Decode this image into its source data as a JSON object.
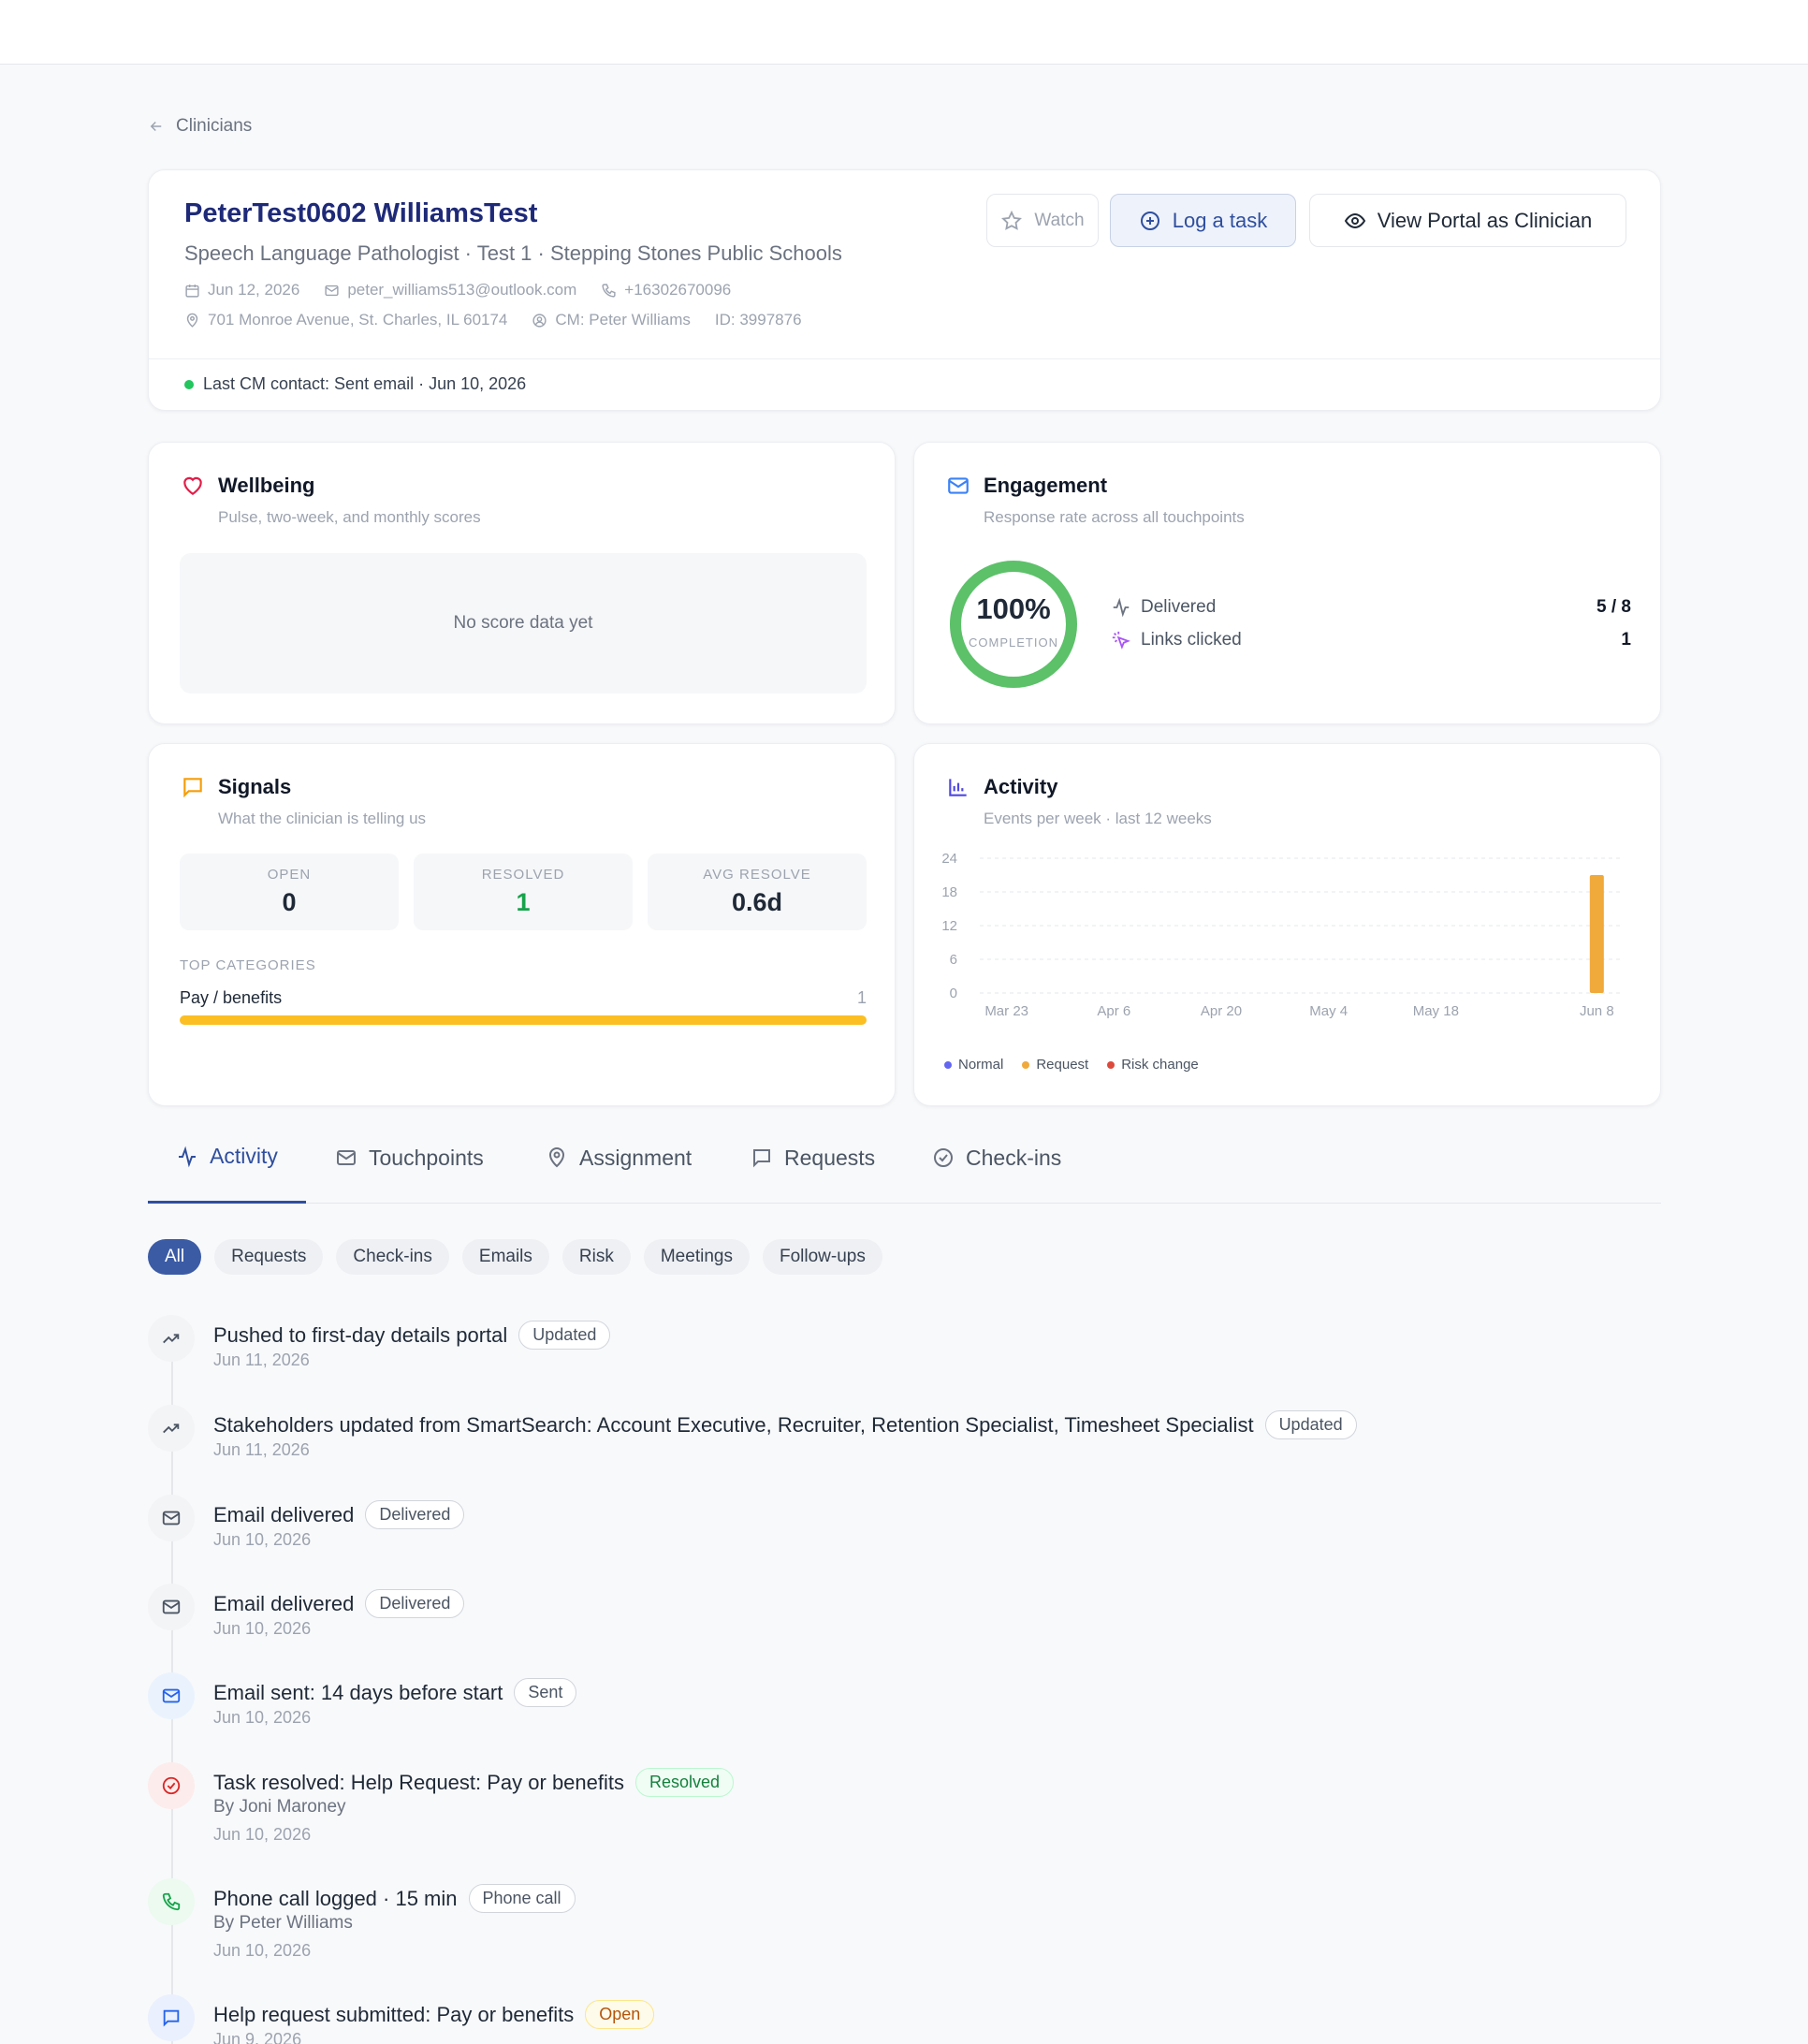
{
  "back_label": "Clinicians",
  "clinician": {
    "name": "PeterTest0602 WilliamsTest",
    "role": "Speech Language Pathologist · Test 1 · Stepping Stones Public Schools",
    "start_date": "Jun 12, 2026",
    "email": "peter_williams513@outlook.com",
    "phone": "+16302670096",
    "address": "701 Monroe Avenue, St. Charles, IL 60174",
    "cm": "CM: Peter Williams",
    "id": "ID: 3997876",
    "last_contact": "Last CM contact: Sent email · Jun 10, 2026"
  },
  "actions": {
    "watch": "Watch",
    "log": "Log a task",
    "view": "View Portal as Clinician"
  },
  "wellbeing": {
    "title": "Wellbeing",
    "sub": "Pulse, two-week, and monthly scores",
    "empty": "No score data yet"
  },
  "engagement": {
    "title": "Engagement",
    "sub": "Response rate across all touchpoints",
    "percent": "100%",
    "percent_label": "COMPLETION",
    "completion": 1.0,
    "delivered_label": "Delivered",
    "delivered_value": "5 / 8",
    "links_label": "Links clicked",
    "links_value": "1"
  },
  "signals": {
    "title": "Signals",
    "sub": "What the clinician is telling us",
    "open_label": "OPEN",
    "open": "0",
    "resolved_label": "RESOLVED",
    "resolved": "1",
    "avg_label": "AVG RESOLVE",
    "avg": "0.6d",
    "top_label": "TOP CATEGORIES",
    "category": "Pay / benefits",
    "category_count": "1"
  },
  "activity_card": {
    "title": "Activity",
    "sub": "Events per week · last 12 weeks",
    "legend": [
      "Normal",
      "Request",
      "Risk change"
    ]
  },
  "chart_data": {
    "type": "bar",
    "ylim": [
      0,
      24
    ],
    "yticks": [
      "0",
      "6",
      "12",
      "18",
      "24"
    ],
    "xticks": [
      "Mar 23",
      "Apr 6",
      "Apr 20",
      "May 4",
      "May 18",
      "Jun 8"
    ],
    "x": [
      "Mar 23",
      "Mar 30",
      "Apr 6",
      "Apr 13",
      "Apr 20",
      "Apr 27",
      "May 4",
      "May 11",
      "May 18",
      "May 25",
      "Jun 1",
      "Jun 8"
    ],
    "series": [
      {
        "name": "Request",
        "values": [
          0,
          0,
          0,
          0,
          0,
          0,
          0,
          0,
          0,
          0,
          0,
          21
        ]
      }
    ],
    "colors": {
      "Normal": "#6366f1",
      "Request": "#f0a93b",
      "Risk change": "#dc4a3c"
    }
  },
  "tabs": [
    "Activity",
    "Touchpoints",
    "Assignment",
    "Requests",
    "Check-ins"
  ],
  "filters": [
    "All",
    "Requests",
    "Check-ins",
    "Emails",
    "Risk",
    "Meetings",
    "Follow-ups"
  ],
  "events": [
    {
      "title": "Pushed to first-day details portal",
      "badge": "Updated",
      "date": "Jun 11, 2026"
    },
    {
      "title": "Stakeholders updated from SmartSearch: Account Executive, Recruiter, Retention Specialist, Timesheet Specialist",
      "badge": "Updated",
      "date": "Jun 11, 2026"
    },
    {
      "title": "Email delivered",
      "badge": "Delivered",
      "date": "Jun 10, 2026"
    },
    {
      "title": "Email delivered",
      "badge": "Delivered",
      "date": "Jun 10, 2026"
    },
    {
      "title": "Email sent: 14 days before start",
      "badge": "Sent",
      "date": "Jun 10, 2026"
    },
    {
      "title": "Task resolved: Help Request: Pay or benefits",
      "badge": "Resolved",
      "by": "By Joni Maroney",
      "date": "Jun 10, 2026"
    },
    {
      "title": "Phone call logged · 15 min",
      "badge": "Phone call",
      "by": "By Peter Williams",
      "date": "Jun 10, 2026"
    },
    {
      "title": "Help request submitted: Pay or benefits",
      "badge": "Open",
      "date": "Jun 9, 2026"
    }
  ]
}
